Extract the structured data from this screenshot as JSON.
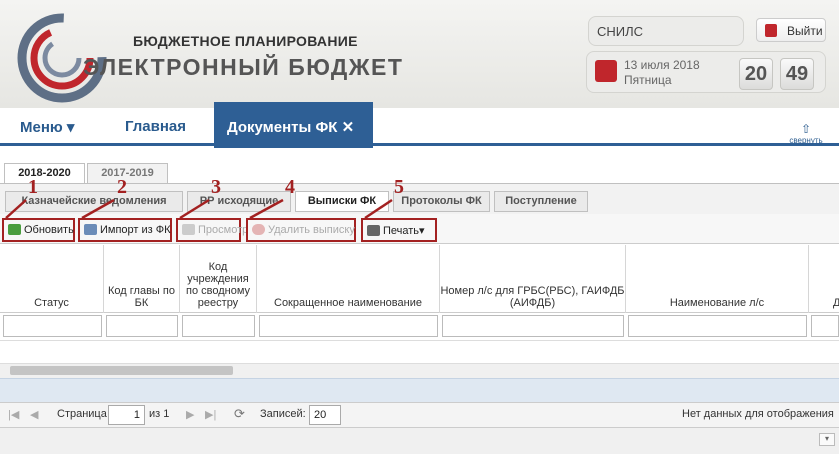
{
  "header": {
    "subtitle": "БЮДЖЕТНОЕ ПЛАНИРОВАНИЕ",
    "title": "ЭЛЕКТРОННЫЙ БЮДЖЕТ",
    "snils_placeholder": "СНИЛС",
    "logout_label": "Выйти",
    "date": "13 июля 2018",
    "weekday": "Пятница",
    "clock_hours": "20",
    "clock_minutes": "49"
  },
  "nav": {
    "menu": "Меню",
    "home": "Главная",
    "active": "Документы ФК",
    "close": "✕",
    "collapse": "свернуть"
  },
  "year_tabs": [
    "2018-2020",
    "2017-2019"
  ],
  "sub_tabs": [
    "Казначейские ведомления",
    "РР исходящие",
    "Выписки ФК",
    "Протоколы ФК",
    "Поступление"
  ],
  "toolbar": {
    "refresh": "Обновить",
    "import": "Импорт из ФК",
    "view": "Просмотр",
    "delete": "Удалить выписку",
    "print": "Печать"
  },
  "annotations": [
    "1",
    "2",
    "3",
    "4",
    "5"
  ],
  "grid": {
    "columns": [
      "Статус",
      "Код главы по БК",
      "Код учреждения по сводному реестру",
      "Сокращенное наименование",
      "Номер л/с для ГРБС(РБС), ГАИФДБ (АИФДБ)",
      "Наименование л/с",
      "Д"
    ]
  },
  "pager": {
    "page_label": "Страница",
    "page_value": "1",
    "of_label": "из 1",
    "records_label": "Записей:",
    "records_value": "20",
    "empty_text": "Нет данных для отображения"
  },
  "colors": {
    "accent": "#2e5f95",
    "annotation": "#a32121"
  }
}
